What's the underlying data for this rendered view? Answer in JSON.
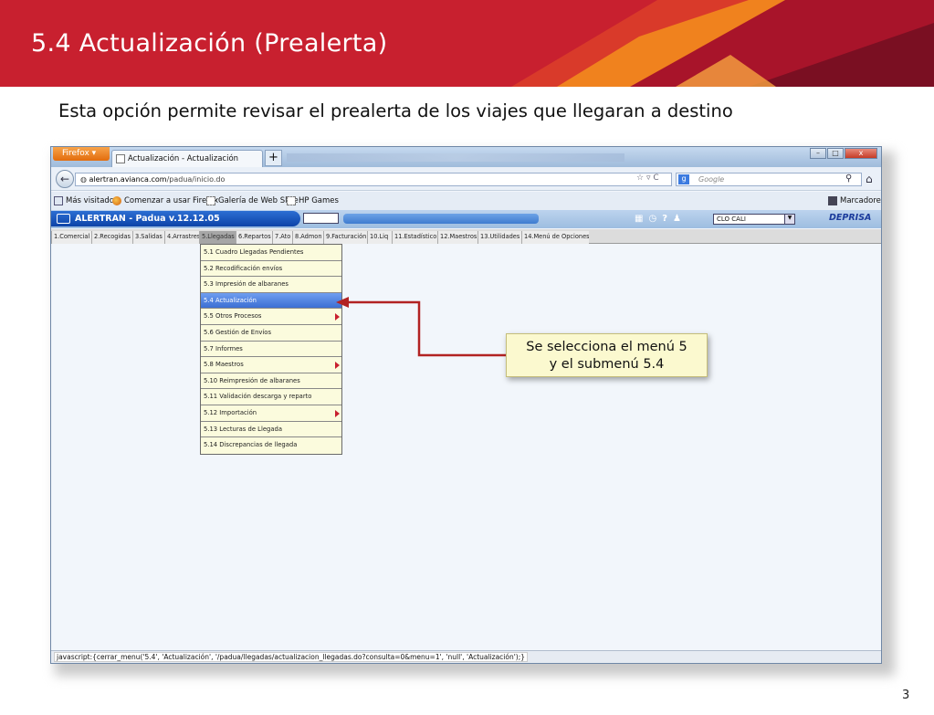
{
  "slide": {
    "title": "5.4 Actualización (Prealerta)",
    "subtitle": "Esta opción permite revisar el prealerta de los viajes que llegaran a destino",
    "page_number": "3",
    "colors": {
      "banner": "#c8202f",
      "banner_accent": "#f0821e",
      "callout_bg": "#fbf9cf",
      "arrow": "#b22222"
    }
  },
  "browser": {
    "firefox_button": "Firefox",
    "tab_title": "Actualización - Actualización",
    "new_tab": "+",
    "url_domain": "alertran.avianca.com",
    "url_path": "/padua/inicio.do",
    "search_placeholder": "Google",
    "bookmarks": [
      "Más visitados",
      "Comenzar a usar Firefox",
      "Galería de Web Slice",
      "HP Games"
    ],
    "bookmarks_right": "Marcadores",
    "status_text": "javascript:{cerrar_menu('5.4', 'Actualización', '/padua/llegadas/actualizacion_llegadas.do?consulta=0&menu=1', 'null', 'Actualización');}"
  },
  "app": {
    "title": "ALERTRAN - Padua  v.12.12.05",
    "city_select": "CLO CALI",
    "brand": "DEPRISA",
    "menu": [
      "1.Comercial",
      "2.Recogidas",
      "3.Salidas",
      "4.Arrastres",
      "5.Llegadas",
      "6.Repartos",
      "7.Ato",
      "8.Admon",
      "9.Facturación",
      "10.Liq",
      "11.Estadístico",
      "12.Maestros",
      "13.Utilidades",
      "14.Menú de Opciones"
    ],
    "selected_menu": "5.Llegadas",
    "submenu": [
      {
        "label": "5.1 Cuadro Llegadas Pendientes",
        "has_children": false,
        "highlighted": false
      },
      {
        "label": "5.2 Recodificación envíos",
        "has_children": false,
        "highlighted": false
      },
      {
        "label": "5.3 Impresión de albaranes",
        "has_children": false,
        "highlighted": false
      },
      {
        "label": "5.4 Actualización",
        "has_children": false,
        "highlighted": true
      },
      {
        "label": "5.5 Otros Procesos",
        "has_children": true,
        "highlighted": false
      },
      {
        "label": "5.6 Gestión de Envíos",
        "has_children": false,
        "highlighted": false
      },
      {
        "label": "5.7 Informes",
        "has_children": false,
        "highlighted": false
      },
      {
        "label": "5.8 Maestros",
        "has_children": true,
        "highlighted": false
      },
      {
        "label": "5.10 Reimpresión de albaranes",
        "has_children": false,
        "highlighted": false
      },
      {
        "label": "5.11 Validación descarga y reparto",
        "has_children": false,
        "highlighted": false
      },
      {
        "label": "5.12 Importación",
        "has_children": true,
        "highlighted": false
      },
      {
        "label": "5.13 Lecturas de Llegada",
        "has_children": false,
        "highlighted": false
      },
      {
        "label": "5.14 Discrepancias de llegada",
        "has_children": false,
        "highlighted": false
      }
    ]
  },
  "callout": {
    "line1": "Se selecciona el menú 5",
    "line2": "y el submenú 5.4"
  }
}
